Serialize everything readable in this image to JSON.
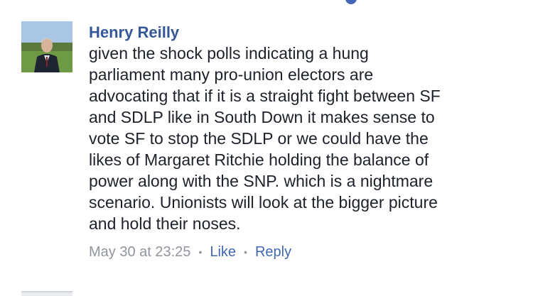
{
  "comment": {
    "author": "Henry Reilly",
    "lines": [
      "given the shock polls indicating a hung",
      "parliament many pro-union electors are",
      "advocating that if it is a straight fight between SF",
      "and SDLP like in South Down it makes sense to",
      "vote SF to stop the SDLP or we could have the",
      "likes of Margaret Ritchie holding the balance of",
      "power along with the SNP. which is a nightmare",
      "scenario. Unionists will look at the bigger picture",
      "and hold their noses."
    ],
    "timestamp": "May 30 at 23:25",
    "separator": "•",
    "like_label": "Like",
    "reply_label": "Reply"
  },
  "colors": {
    "author": "#365899",
    "link": "#4267b2",
    "meta": "#90949c",
    "text": "#1d2129"
  },
  "icons": {
    "avatar": "profile-photo"
  }
}
